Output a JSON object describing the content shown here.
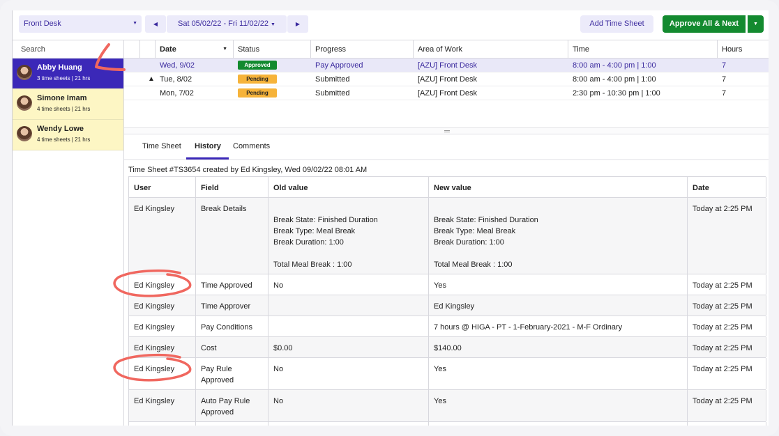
{
  "topbar": {
    "location": "Front Desk",
    "date_range": "Sat 05/02/22 - Fri 11/02/22",
    "add_time_sheet": "Add Time Sheet",
    "approve_all_next": "Approve All & Next"
  },
  "sidebar": {
    "search_placeholder": "Search",
    "employees": [
      {
        "name": "Abby Huang",
        "meta": "3 time sheets | 21 hrs"
      },
      {
        "name": "Simone Imam",
        "meta": "4 time sheets | 21 hrs"
      },
      {
        "name": "Wendy Lowe",
        "meta": "4 time sheets | 21 hrs"
      }
    ]
  },
  "grid": {
    "headers": {
      "date": "Date",
      "status": "Status",
      "progress": "Progress",
      "area": "Area of Work",
      "time": "Time",
      "hours": "Hours"
    },
    "rows": [
      {
        "date": "Wed, 9/02",
        "status": "Approved",
        "progress": "Pay Approved",
        "area": "[AZU] Front Desk",
        "time": "8:00 am - 4:00 pm | 1:00",
        "hours": "7"
      },
      {
        "date": "Tue, 8/02",
        "status": "Pending",
        "progress": "Submitted",
        "area": "[AZU] Front Desk",
        "time": "8:00 am - 4:00 pm | 1:00",
        "hours": "7"
      },
      {
        "date": "Mon, 7/02",
        "status": "Pending",
        "progress": "Submitted",
        "area": "[AZU] Front Desk",
        "time": "2:30 pm - 10:30 pm | 1:00",
        "hours": "7"
      }
    ]
  },
  "tabs": {
    "time_sheet": "Time Sheet",
    "history": "History",
    "comments": "Comments"
  },
  "history": {
    "caption": "Time Sheet #TS3654  created by Ed Kingsley, Wed 09/02/22 08:01 AM",
    "headers": {
      "user": "User",
      "field": "Field",
      "old": "Old value",
      "new": "New value",
      "date": "Date"
    },
    "rows": [
      {
        "user": "Ed Kingsley",
        "field": "Break Details",
        "old": "\nBreak State: Finished Duration\nBreak Type: Meal Break\nBreak Duration: 1:00\n\nTotal Meal Break : 1:00",
        "new": "\nBreak State: Finished Duration\nBreak Type: Meal Break\nBreak Duration: 1:00\n\nTotal Meal Break : 1:00",
        "date": "Today at 2:25 PM"
      },
      {
        "user": "Ed Kingsley",
        "field": "Time Approved",
        "old": "No",
        "new": "Yes",
        "date": "Today at 2:25 PM"
      },
      {
        "user": "Ed Kingsley",
        "field": "Time Approver",
        "old": "",
        "new": "Ed Kingsley",
        "date": "Today at 2:25 PM"
      },
      {
        "user": "Ed Kingsley",
        "field": "Pay Conditions",
        "old": "",
        "new": "7 hours @ HIGA - PT - 1-February-2021 - M-F Ordinary",
        "date": "Today at 2:25 PM"
      },
      {
        "user": "Ed Kingsley",
        "field": "Cost",
        "old": "$0.00",
        "new": "$140.00",
        "date": "Today at 2:25 PM"
      },
      {
        "user": "Ed Kingsley",
        "field": "Pay Rule\nApproved",
        "old": "No",
        "new": "Yes",
        "date": "Today at 2:25 PM"
      },
      {
        "user": "Ed Kingsley",
        "field": "Auto Pay Rule\nApproved",
        "old": "No",
        "new": "Yes",
        "date": "Today at 2:25 PM"
      }
    ]
  },
  "colors": {
    "accent": "#3b28b8",
    "approve_green": "#138a2f",
    "pending_orange": "#f6b33a",
    "annotation": "#f0675f"
  }
}
